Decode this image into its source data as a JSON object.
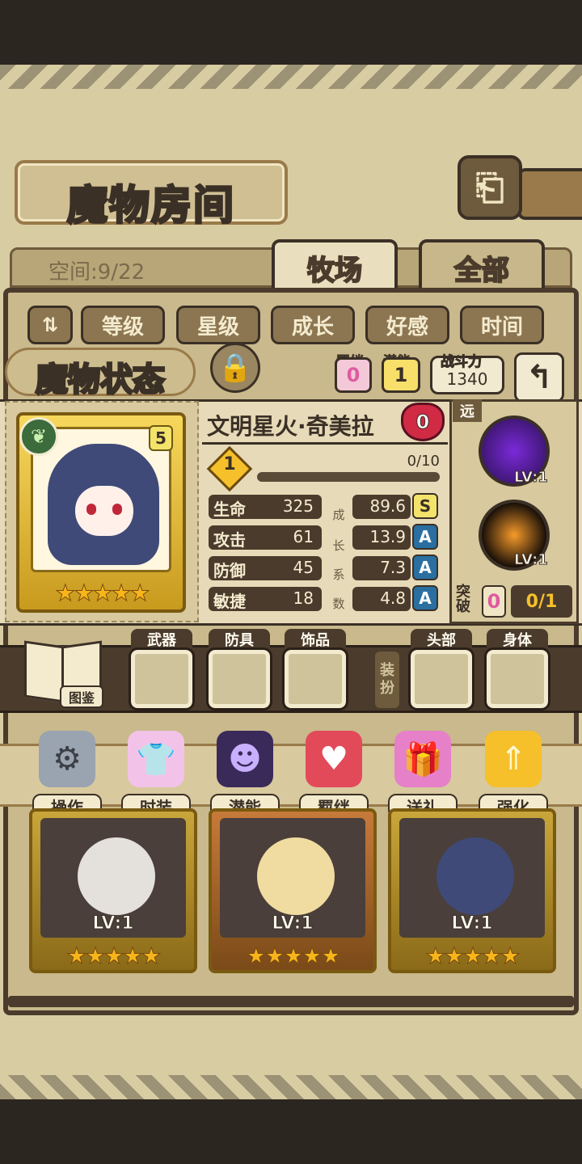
{
  "header": {
    "title": "魔物房间",
    "back_icon": "back-arrow-icon"
  },
  "tabs": {
    "space_label": "空间:9/22",
    "items": [
      {
        "label": "牧场",
        "active": true
      },
      {
        "label": "全部",
        "active": false
      }
    ]
  },
  "filters": {
    "sort_icon": "sort-toggle-icon",
    "items": [
      "等级",
      "星级",
      "成长",
      "好感",
      "时间"
    ]
  },
  "status": {
    "title": "魔物状态",
    "lock_icon": "padlock-icon",
    "bond_label": "羁绊",
    "bond_value": "0",
    "potential_label": "潜能",
    "potential_value": "1",
    "power_label": "战斗力",
    "power_value": "1340",
    "return_icon": "return-arrow-icon"
  },
  "monster": {
    "name": "文明星火·奇美拉",
    "affection": "0",
    "element_icon": "leaf-icon",
    "rank": "5",
    "stars": 5,
    "level": "1",
    "exp_text": "0/10",
    "exp_fraction": 0,
    "growth_label_chars": [
      "成",
      "长",
      "系",
      "数"
    ],
    "stats": [
      {
        "name": "生命",
        "value": "325",
        "growth": "89.6",
        "grade": "S"
      },
      {
        "name": "攻击",
        "value": "61",
        "growth": "13.9",
        "grade": "A"
      },
      {
        "name": "防御",
        "value": "45",
        "growth": "7.3",
        "grade": "A"
      },
      {
        "name": "敏捷",
        "value": "18",
        "growth": "4.8",
        "grade": "A"
      }
    ]
  },
  "skills": {
    "range_tag": "远",
    "items": [
      {
        "icon": "dark-vortex-skill-icon",
        "level": "LV:1"
      },
      {
        "icon": "fire-burst-skill-icon",
        "level": "LV:1"
      }
    ],
    "breakthrough_label": "突破",
    "breakthrough_value": "0",
    "breakthrough_count": "0/1"
  },
  "equipment": {
    "book_label": "图鉴",
    "slots_left": [
      "武器",
      "防具",
      "饰品"
    ],
    "dress_label": "装扮",
    "slots_right": [
      "头部",
      "身体"
    ]
  },
  "actions": [
    {
      "label": "操作",
      "icon": "gear-icon"
    },
    {
      "label": "时装",
      "icon": "outfit-icon"
    },
    {
      "label": "潜能",
      "icon": "shadow-figure-icon"
    },
    {
      "label": "羁绊",
      "icon": "hearts-icon"
    },
    {
      "label": "送礼",
      "icon": "gift-icon"
    },
    {
      "label": "强化",
      "icon": "upgrade-arrows-icon"
    }
  ],
  "roster": [
    {
      "level": "LV:1",
      "stars": 5,
      "frame": "gold"
    },
    {
      "level": "LV:1",
      "stars": 5,
      "frame": "bronze"
    },
    {
      "level": "LV:1",
      "stars": 5,
      "frame": "gold"
    }
  ]
}
